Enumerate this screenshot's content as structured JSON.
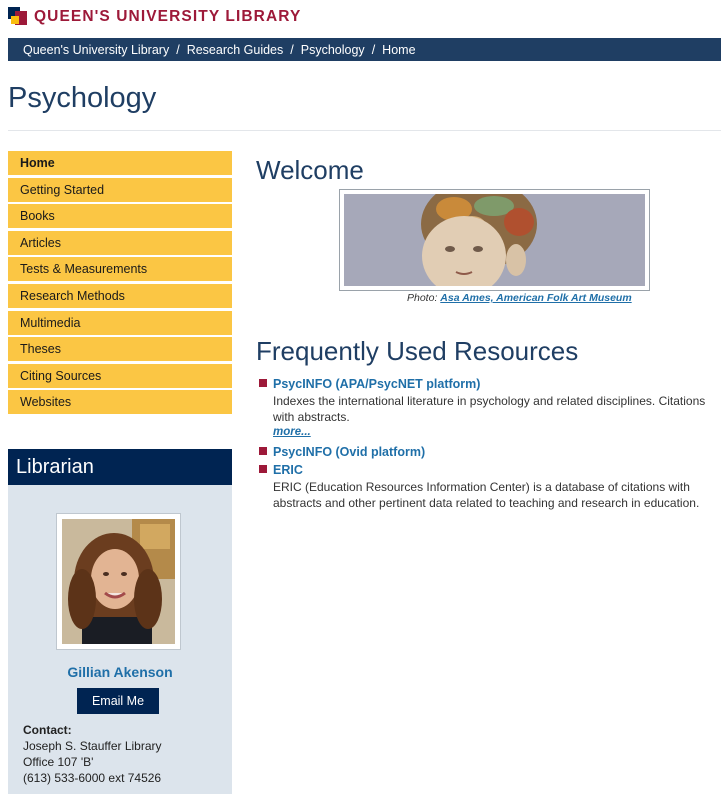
{
  "header": {
    "library_name": "QUEEN'S UNIVERSITY LIBRARY"
  },
  "breadcrumb": {
    "items": [
      "Queen's University Library",
      "Research Guides",
      "Psychology",
      "Home"
    ],
    "separator": "/"
  },
  "page_title": "Psychology",
  "nav": {
    "items": [
      {
        "label": "Home",
        "active": true
      },
      {
        "label": "Getting Started"
      },
      {
        "label": "Books"
      },
      {
        "label": "Articles"
      },
      {
        "label": "Tests & Measurements"
      },
      {
        "label": "Research Methods"
      },
      {
        "label": "Multimedia"
      },
      {
        "label": "Theses"
      },
      {
        "label": "Citing Sources"
      },
      {
        "label": "Websites"
      }
    ]
  },
  "librarian": {
    "heading": "Librarian",
    "name": "Gillian Akenson",
    "email_button": "Email Me",
    "contact_label": "Contact:",
    "contact_lines": [
      "Joseph S. Stauffer Library",
      "Office 107 'B'",
      "(613) 533-6000 ext 74526"
    ]
  },
  "welcome": {
    "heading": "Welcome",
    "caption_prefix": "Photo: ",
    "caption_credit": "Asa Ames, American Folk Art Museum"
  },
  "resources": {
    "heading": "Frequently Used Resources",
    "items": [
      {
        "title": "PsycINFO (APA/PsycNET platform)",
        "description": "Indexes the international literature in psychology and related disciplines. Citations with abstracts.",
        "more": "more..."
      },
      {
        "title": "PsycINFO (Ovid platform)"
      },
      {
        "title": "ERIC",
        "description": "ERIC (Education Resources Information Center) is a database of citations with abstracts and other pertinent data related to teaching and research in education."
      }
    ]
  },
  "colors": {
    "brand_red": "#9d1939",
    "navy": "#002452",
    "gold": "#fbc644",
    "link_blue": "#1f6fa8"
  }
}
